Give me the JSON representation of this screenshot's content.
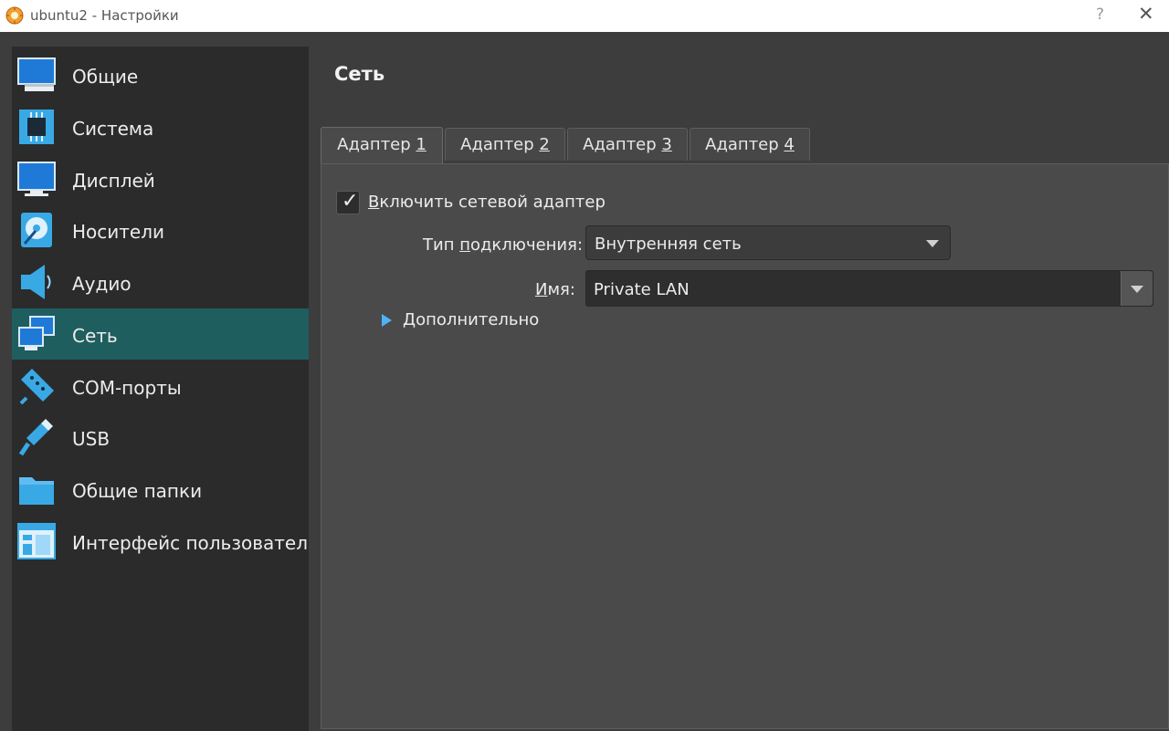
{
  "window": {
    "title": "ubuntu2 - Настройки",
    "help_label": "?",
    "close_label": "✕"
  },
  "sidebar": {
    "items": [
      {
        "label": "Общие",
        "icon": "general-monitor-icon"
      },
      {
        "label": "Система",
        "icon": "chip-icon"
      },
      {
        "label": "Дисплей",
        "icon": "display-monitor-icon"
      },
      {
        "label": "Носители",
        "icon": "disk-icon"
      },
      {
        "label": "Аудио",
        "icon": "speaker-icon"
      },
      {
        "label": "Сеть",
        "icon": "network-icon",
        "selected": true
      },
      {
        "label": "COM-порты",
        "icon": "serial-port-icon"
      },
      {
        "label": "USB",
        "icon": "usb-icon"
      },
      {
        "label": "Общие папки",
        "icon": "folder-icon"
      },
      {
        "label": "Интерфейс пользователя",
        "icon": "ui-window-icon"
      }
    ]
  },
  "content": {
    "title": "Сеть",
    "tabs": [
      {
        "prefix": "Адаптер ",
        "key": "1",
        "active": true
      },
      {
        "prefix": "Адаптер ",
        "key": "2"
      },
      {
        "prefix": "Адаптер ",
        "key": "3"
      },
      {
        "prefix": "Адаптер ",
        "key": "4"
      }
    ],
    "enable_adapter": {
      "label_first": "В",
      "label_rest": "ключить сетевой адаптер",
      "checked": true,
      "check_glyph": "✓"
    },
    "connection_type": {
      "label_before": "Тип ",
      "label_key": "п",
      "label_after": "одключения:",
      "value": "Внутренняя сеть"
    },
    "name": {
      "label_key": "И",
      "label_after": "мя:",
      "value": "Private LAN"
    },
    "advanced": {
      "label_first": "Д",
      "label_rest": "ополнительно"
    }
  },
  "colors": {
    "accent": "#4fb2f5",
    "selection": "#1f5e5f",
    "sidebar_bg": "#2b2b2b",
    "panel_bg": "#4a4a4a"
  }
}
